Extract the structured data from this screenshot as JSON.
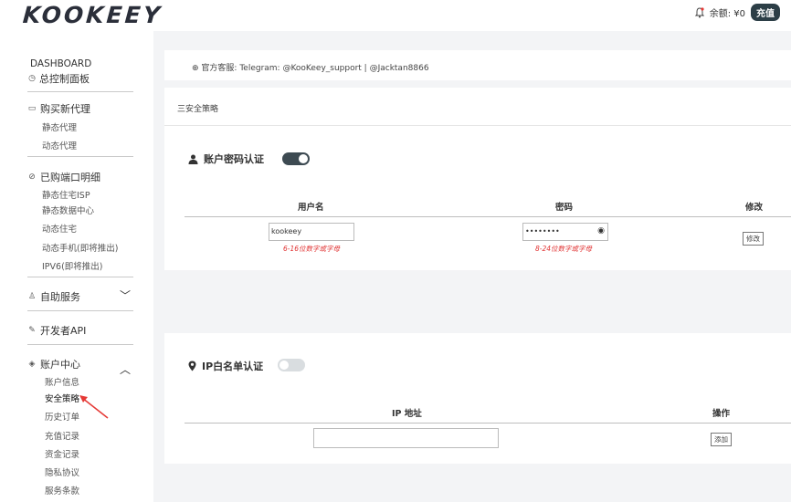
{
  "header": {
    "logo": "KOOKEEY",
    "balance_label": "余额: ¥0",
    "recharge_label": "充值"
  },
  "sidebar": {
    "dashboard_en": "DASHBOARD",
    "dashboard_cn": "总控制面板",
    "buy": {
      "title": "购买新代理",
      "items": [
        "静态代理",
        "动态代理"
      ]
    },
    "purchased": {
      "title": "已购端口明细",
      "items": [
        "静态住宅ISP",
        "静态数据中心",
        "动态住宅",
        "动态手机(即将推出)",
        "IPV6(即将推出)"
      ]
    },
    "self_service": "自助服务",
    "developer": "开发者API",
    "account": {
      "title": "账户中心",
      "items": [
        "账户信息",
        "安全策略",
        "历史订单",
        "充值记录",
        "资金记录",
        "隐私协议",
        "服务条款"
      ]
    }
  },
  "customer_service": "官方客服:  Telegram: @KooKeey_support | @Jacktan8866",
  "policy": {
    "heading": "三安全策略",
    "password_auth": {
      "title": "账户密码认证",
      "enabled": true,
      "col_user": "用户名",
      "col_pass": "密码",
      "col_edit": "修改",
      "username_value": "kookeey",
      "password_value": "••••••••",
      "username_hint": "6-16位数字或字母",
      "password_hint": "8-24位数字或字母",
      "edit_button": "修改"
    },
    "ip_whitelist": {
      "title": "IP白名单认证",
      "enabled": false,
      "col_ip": "IP 地址",
      "col_action": "操作",
      "ip_value": "",
      "add_button": "添加"
    }
  }
}
